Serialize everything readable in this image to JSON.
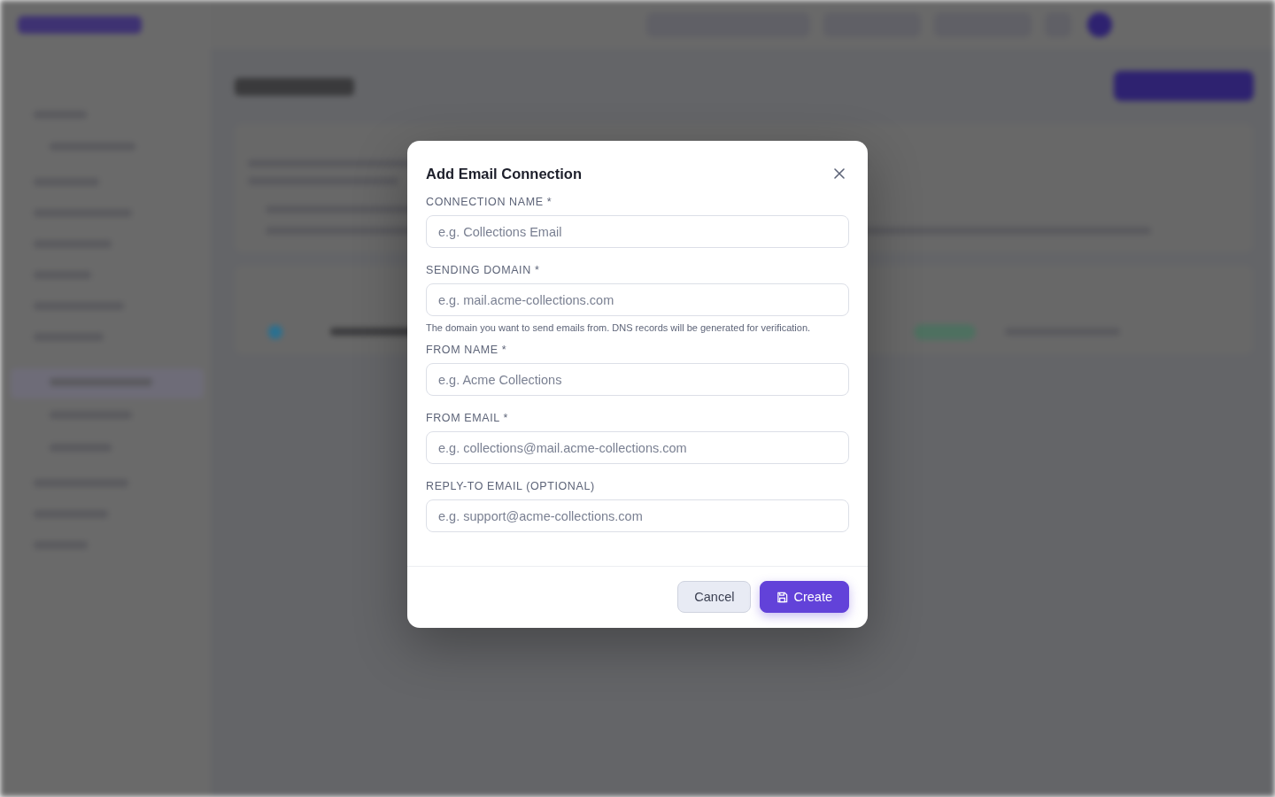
{
  "dialog": {
    "title": "Add Email Connection",
    "fields": [
      {
        "label": "CONNECTION NAME *",
        "placeholder": "e.g. Collections Email"
      },
      {
        "label": "SENDING DOMAIN *",
        "placeholder": "e.g. mail.acme-collections.com",
        "hint": "The domain you want to send emails from. DNS records will be generated for verification."
      },
      {
        "label": "FROM NAME *",
        "placeholder": "e.g. Acme Collections"
      },
      {
        "label": "FROM EMAIL *",
        "placeholder": "e.g. collections@mail.acme-collections.com"
      },
      {
        "label": "REPLY-TO EMAIL (OPTIONAL)",
        "placeholder": "e.g. support@acme-collections.com"
      }
    ],
    "buttons": [
      {
        "label": "Cancel",
        "kind": "secondary"
      },
      {
        "label": "Create",
        "kind": "primary"
      }
    ]
  }
}
